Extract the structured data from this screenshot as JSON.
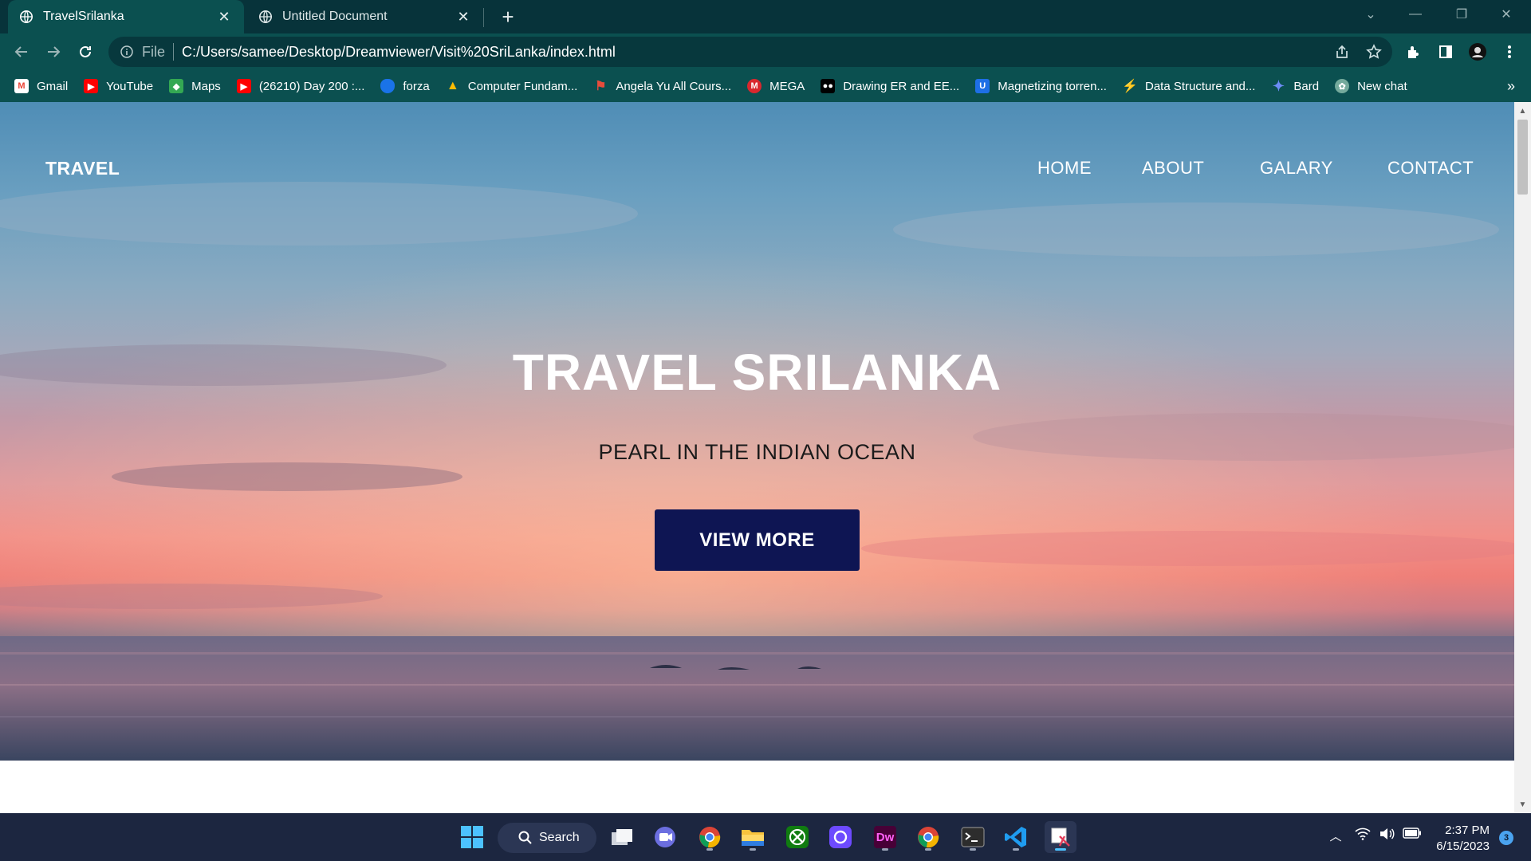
{
  "browser": {
    "tabs": [
      {
        "title": "TravelSrilanka",
        "active": true
      },
      {
        "title": "Untitled Document",
        "active": false
      }
    ],
    "address": {
      "scheme_label": "File",
      "url": "C:/Users/samee/Desktop/Dreamviewer/Visit%20SriLanka/index.html"
    },
    "bookmarks": [
      {
        "label": "Gmail",
        "icon": "gmail-icon",
        "color": "#ea4335"
      },
      {
        "label": "YouTube",
        "icon": "youtube-icon",
        "color": "#ff0000"
      },
      {
        "label": "Maps",
        "icon": "maps-icon",
        "color": "#34a853"
      },
      {
        "label": "(26210) Day 200 :...",
        "icon": "youtube-icon",
        "color": "#ff0000"
      },
      {
        "label": "forza",
        "icon": "shield-icon",
        "color": "#1a73e8"
      },
      {
        "label": "Computer Fundam...",
        "icon": "drive-icon",
        "color": "#fbbc04"
      },
      {
        "label": "Angela Yu All Cours...",
        "icon": "flag-icon",
        "color": "#e74c3c"
      },
      {
        "label": "MEGA",
        "icon": "mega-icon",
        "color": "#d9272e"
      },
      {
        "label": "Drawing ER and EE...",
        "icon": "medium-icon",
        "color": "#000000"
      },
      {
        "label": "Magnetizing torren...",
        "icon": "magnet-icon",
        "color": "#1e6fe6"
      },
      {
        "label": "Data Structure and...",
        "icon": "bolt-icon",
        "color": "#8a3ffc"
      },
      {
        "label": "Bard",
        "icon": "sparkle-icon",
        "color": "#6d8cf5"
      },
      {
        "label": "New chat",
        "icon": "chatgpt-icon",
        "color": "#74aa9c"
      }
    ],
    "bookmarks_more": "»"
  },
  "page": {
    "brand": "TRAVEL",
    "nav": {
      "home": "HOME",
      "about": "ABOUT",
      "galary": "GALARY",
      "contact": "CONTACT"
    },
    "hero": {
      "title": "TRAVEL SRILANKA",
      "subtitle": "PEARL IN THE INDIAN OCEAN",
      "button": "VIEW MORE"
    }
  },
  "taskbar": {
    "search_label": "Search",
    "apps": [
      "start-icon",
      "task-view-icon",
      "teams-chat-icon",
      "chrome-icon",
      "file-explorer-icon",
      "xbox-icon",
      "proton-icon",
      "dreamweaver-icon",
      "chrome-icon",
      "terminal-icon",
      "vscode-icon",
      "snipping-tool-icon"
    ],
    "dreamweaver_label": "Dw",
    "time": "2:37 PM",
    "date": "6/15/2023",
    "notification_count": "3"
  },
  "colors": {
    "tab_strip": "#07333a",
    "toolbar": "#0b5050",
    "hero_button": "#0e1553",
    "taskbar": "#1c2640"
  }
}
